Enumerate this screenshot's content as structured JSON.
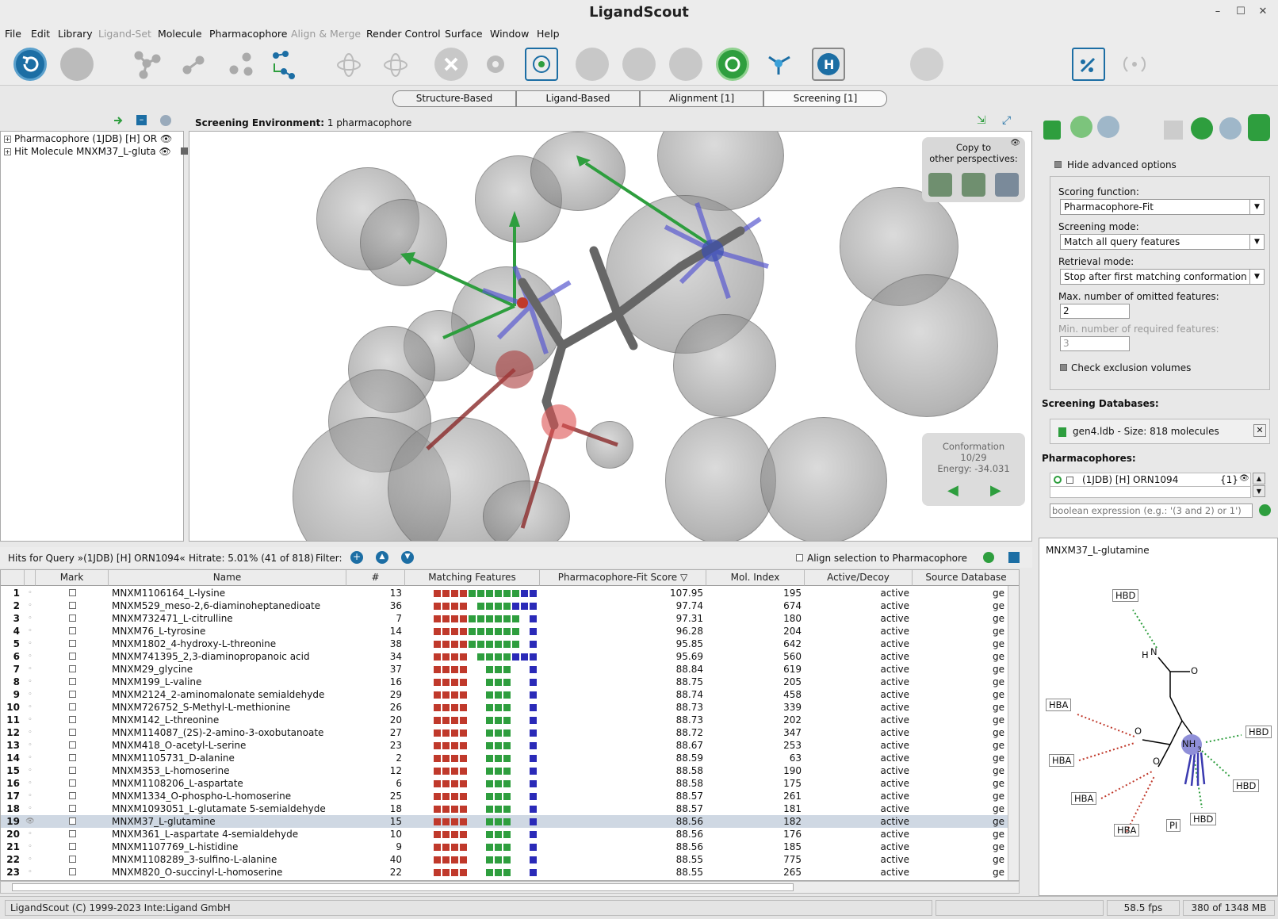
{
  "app": {
    "title": "LigandScout"
  },
  "menu": [
    "File",
    "Edit",
    "Library",
    "Ligand-Set",
    "Molecule",
    "Pharmacophore",
    "Align & Merge",
    "Render Control",
    "Surface",
    "Window",
    "Help"
  ],
  "tabs": [
    "Structure-Based",
    "Ligand-Based",
    "Alignment [1]",
    "Screening [1]"
  ],
  "tree": {
    "items": [
      "Pharmacophore (1JDB) [H] OR",
      "Hit Molecule MNXM37_L-gluta"
    ]
  },
  "view": {
    "env_label": "Screening Environment:",
    "env_value": "1 pharmacophore",
    "copy_title": "Copy to",
    "copy_subtitle": "other perspectives:",
    "conf_label": "Conformation",
    "conf_value": "10/29",
    "energy": "Energy: -34.031"
  },
  "hits": {
    "title": "Hits for Query",
    "query": "»(1JDB) [H] ORN1094«",
    "hitrate": "Hitrate: 5.01% (41 of 818)",
    "filter": "Filter:",
    "align": "Align selection to Pharmacophore"
  },
  "table": {
    "columns": [
      "Mark",
      "Name",
      "#",
      "Matching Features",
      "Pharmacophore-Fit Score",
      "Mol. Index",
      "Active/Decoy",
      "Source Database"
    ],
    "rows": [
      {
        "n": "1",
        "name": "MNXM1106164_L-lysine",
        "num": "13",
        "score": "107.95",
        "idx": "195",
        "act": "active",
        "src": "ge",
        "f": "rrrrggggggbb"
      },
      {
        "n": "2",
        "name": "MNXM529_meso-2,6-diaminoheptanedioate",
        "num": "36",
        "score": "97.74",
        "idx": "674",
        "act": "active",
        "src": "ge",
        "f": "rrrr_ggggbbb"
      },
      {
        "n": "3",
        "name": "MNXM732471_L-citrulline",
        "num": "7",
        "score": "97.31",
        "idx": "180",
        "act": "active",
        "src": "ge",
        "f": "rrrrgggggg_b"
      },
      {
        "n": "4",
        "name": "MNXM76_L-tyrosine",
        "num": "14",
        "score": "96.28",
        "idx": "204",
        "act": "active",
        "src": "ge",
        "f": "rrrrgggggg_b"
      },
      {
        "n": "5",
        "name": "MNXM1802_4-hydroxy-L-threonine",
        "num": "38",
        "score": "95.85",
        "idx": "642",
        "act": "active",
        "src": "ge",
        "f": "rrrrgggggg_b"
      },
      {
        "n": "6",
        "name": "MNXM741395_2,3-diaminopropanoic acid",
        "num": "34",
        "score": "95.69",
        "idx": "560",
        "act": "active",
        "src": "ge",
        "f": "rrrr_ggggbbb"
      },
      {
        "n": "7",
        "name": "MNXM29_glycine",
        "num": "37",
        "score": "88.84",
        "idx": "619",
        "act": "active",
        "src": "ge",
        "f": "rrrr__ggg__b"
      },
      {
        "n": "8",
        "name": "MNXM199_L-valine",
        "num": "16",
        "score": "88.75",
        "idx": "205",
        "act": "active",
        "src": "ge",
        "f": "rrrr__ggg__b"
      },
      {
        "n": "9",
        "name": "MNXM2124_2-aminomalonate semialdehyde",
        "num": "29",
        "score": "88.74",
        "idx": "458",
        "act": "active",
        "src": "ge",
        "f": "rrrr__ggg__b"
      },
      {
        "n": "10",
        "name": "MNXM726752_S-Methyl-L-methionine",
        "num": "26",
        "score": "88.73",
        "idx": "339",
        "act": "active",
        "src": "ge",
        "f": "rrrr__ggg__b"
      },
      {
        "n": "11",
        "name": "MNXM142_L-threonine",
        "num": "20",
        "score": "88.73",
        "idx": "202",
        "act": "active",
        "src": "ge",
        "f": "rrrr__ggg__b"
      },
      {
        "n": "12",
        "name": "MNXM114087_(2S)-2-amino-3-oxobutanoate",
        "num": "27",
        "score": "88.72",
        "idx": "347",
        "act": "active",
        "src": "ge",
        "f": "rrrr__ggg__b"
      },
      {
        "n": "13",
        "name": "MNXM418_O-acetyl-L-serine",
        "num": "23",
        "score": "88.67",
        "idx": "253",
        "act": "active",
        "src": "ge",
        "f": "rrrr__ggg__b"
      },
      {
        "n": "14",
        "name": "MNXM1105731_D-alanine",
        "num": "2",
        "score": "88.59",
        "idx": "63",
        "act": "active",
        "src": "ge",
        "f": "rrrr__ggg__b"
      },
      {
        "n": "15",
        "name": "MNXM353_L-homoserine",
        "num": "12",
        "score": "88.58",
        "idx": "190",
        "act": "active",
        "src": "ge",
        "f": "rrrr__ggg__b"
      },
      {
        "n": "16",
        "name": "MNXM1108206_L-aspartate",
        "num": "6",
        "score": "88.58",
        "idx": "175",
        "act": "active",
        "src": "ge",
        "f": "rrrr__ggg__b"
      },
      {
        "n": "17",
        "name": "MNXM1334_O-phospho-L-homoserine",
        "num": "25",
        "score": "88.57",
        "idx": "261",
        "act": "active",
        "src": "ge",
        "f": "rrrr__ggg__b"
      },
      {
        "n": "18",
        "name": "MNXM1093051_L-glutamate 5-semialdehyde",
        "num": "18",
        "score": "88.57",
        "idx": "181",
        "act": "active",
        "src": "ge",
        "f": "rrrr__ggg__b"
      },
      {
        "n": "19",
        "name": "MNXM37_L-glutamine",
        "num": "15",
        "score": "88.56",
        "idx": "182",
        "act": "active",
        "src": "ge",
        "f": "rrrr__ggg__b",
        "sel": true
      },
      {
        "n": "20",
        "name": "MNXM361_L-aspartate 4-semialdehyde",
        "num": "10",
        "score": "88.56",
        "idx": "176",
        "act": "active",
        "src": "ge",
        "f": "rrrr__ggg__b"
      },
      {
        "n": "21",
        "name": "MNXM1107769_L-histidine",
        "num": "9",
        "score": "88.56",
        "idx": "185",
        "act": "active",
        "src": "ge",
        "f": "rrrr__ggg__b"
      },
      {
        "n": "22",
        "name": "MNXM1108289_3-sulfino-L-alanine",
        "num": "40",
        "score": "88.55",
        "idx": "775",
        "act": "active",
        "src": "ge",
        "f": "rrrr__ggg__b"
      },
      {
        "n": "23",
        "name": "MNXM820_O-succinyl-L-homoserine",
        "num": "22",
        "score": "88.55",
        "idx": "265",
        "act": "active",
        "src": "ge",
        "f": "rrrr__ggg__b"
      }
    ]
  },
  "settings": {
    "hide_advanced": "Hide advanced options",
    "scoring_label": "Scoring function:",
    "scoring_value": "Pharmacophore-Fit",
    "mode_label": "Screening mode:",
    "mode_value": "Match all query features",
    "retrieval_label": "Retrieval mode:",
    "retrieval_value": "Stop after first matching conformation",
    "omit_label": "Max. number of omitted features:",
    "omit_value": "2",
    "req_label": "Min. number of required features:",
    "req_value": "3",
    "excl_label": "Check exclusion volumes",
    "db_title": "Screening Databases:",
    "db_item": "gen4.ldb - Size: 818 molecules",
    "ph_title": "Pharmacophores:",
    "ph_item": "(1JDB) [H] ORN1094",
    "ph_count": "{1}",
    "bool_placeholder": "boolean expression (e.g.: '(3 and 2) or 1')"
  },
  "mol2d": {
    "title": "MNXM37_L-glutamine",
    "labels": [
      "HBD",
      "H",
      "N",
      "O",
      "HBA",
      "O",
      "HBA",
      "O",
      "NH",
      "3",
      "HBD",
      "HBD",
      "HBA",
      "HBA",
      "PI",
      "HBD"
    ]
  },
  "status": {
    "copyright": "LigandScout (C) 1999-2023 Inte:Ligand GmbH",
    "fps": "58.5 fps",
    "memory": "380 of 1348 MB"
  },
  "colors": {
    "hba": "#c0392b",
    "hbd": "#2e9e3e",
    "pi": "#2a2ab8",
    "accent": "#1c6ea4"
  }
}
